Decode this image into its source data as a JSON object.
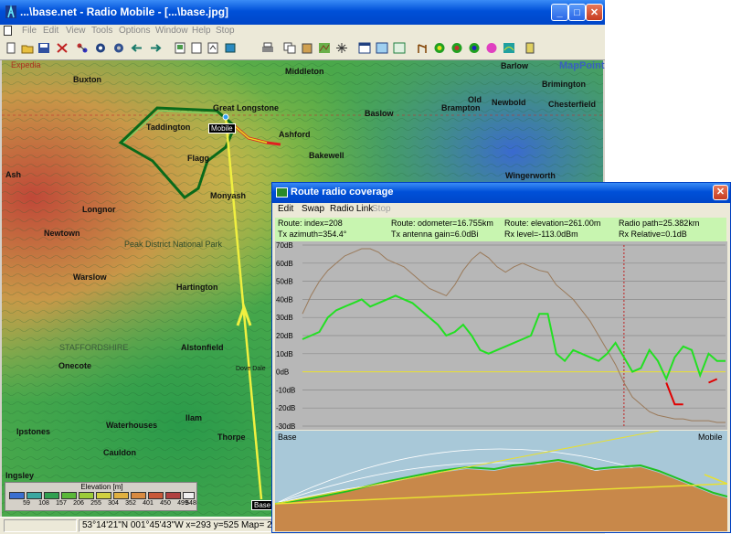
{
  "window": {
    "title": "...\\base.net - Radio Mobile - [...\\base.jpg]",
    "minimize": "_",
    "maximize": "□",
    "close": "✕"
  },
  "menu": [
    "File",
    "Edit",
    "View",
    "Tools",
    "Options",
    "Window",
    "Help",
    "Stop"
  ],
  "toolbar_icons": [
    "new-icon",
    "open-icon",
    "save-icon",
    "properties-icon",
    "network-icon",
    "units-icon",
    "systems-icon",
    "import-icon",
    "export-icon",
    "extract-icon",
    "pictures-icon",
    "elevation-icon",
    "merge-icon",
    "print-icon",
    "copy-icon",
    "paste-icon",
    "map-icon",
    "grid-icon",
    "window-icon",
    "zoom-icon",
    "fit-icon",
    "link-icon",
    "coverage-icon",
    "polar-icon",
    "cartesian-icon",
    "spectrum-icon",
    "rainbow-icon",
    "calculator-icon"
  ],
  "map": {
    "towns": [
      {
        "name": "Buxton"
      },
      {
        "name": "Middleton"
      },
      {
        "name": "Barlow"
      },
      {
        "name": "Brimington"
      },
      {
        "name": "Great Longstone"
      },
      {
        "name": "Old"
      },
      {
        "name": "Brampton"
      },
      {
        "name": "Newbold"
      },
      {
        "name": "Baslow"
      },
      {
        "name": "Chesterfield"
      },
      {
        "name": "Taddington"
      },
      {
        "name": "Ashford"
      },
      {
        "name": "Bakewell"
      },
      {
        "name": "Flagg"
      },
      {
        "name": "Wingerworth"
      },
      {
        "name": "Monyash"
      },
      {
        "name": "Longnor"
      },
      {
        "name": "Newtown"
      },
      {
        "name": "Peak District National Park"
      },
      {
        "name": "Warslow"
      },
      {
        "name": "Hartington"
      },
      {
        "name": "STAFFORDSHIRE"
      },
      {
        "name": "Onecote"
      },
      {
        "name": "Alstonfield"
      },
      {
        "name": "Ilam"
      },
      {
        "name": "Ipstones"
      },
      {
        "name": "Waterhouses"
      },
      {
        "name": "Thorpe"
      },
      {
        "name": "Cauldon"
      },
      {
        "name": "Ingsley"
      },
      {
        "name": "Expedia"
      },
      {
        "name": "MapPoint"
      },
      {
        "name": "Dove Dale"
      },
      {
        "name": "Ash"
      }
    ],
    "mobile_label": "Mobile",
    "base_label": "Base",
    "legend": {
      "title": "Elevation [m]",
      "values": [
        "59",
        "108",
        "157",
        "206",
        "255",
        "304",
        "352",
        "401",
        "450",
        "499",
        "548"
      ],
      "colors": [
        "#3a6fd0",
        "#3aa7a0",
        "#30a050",
        "#5ab838",
        "#9ccc38",
        "#d0d040",
        "#e0b040",
        "#d88a40",
        "#c85838",
        "#b04040",
        "#f0f0f0"
      ]
    }
  },
  "status": {
    "coords": "53°14'21\"N  001°45'43\"W  x=293 y=525 Map= 261m"
  },
  "coverage_window": {
    "title": "Route radio coverage",
    "close": "✕",
    "menu": [
      {
        "label": "Edit",
        "enabled": true
      },
      {
        "label": "Swap",
        "enabled": true
      },
      {
        "label": "Radio Link",
        "enabled": true
      },
      {
        "label": "Stop",
        "enabled": false
      }
    ],
    "info_row1": [
      "Route: index=208",
      "Route: odometer=16.755km",
      "Route: elevation=261.00m",
      "Radio path=25.382km"
    ],
    "info_row2": [
      "Tx azimuth=354.4°",
      "Tx antenna gain=6.0dBi",
      "Rx level=-113.0dBm",
      "Rx Relative=0.1dB"
    ],
    "profile_left": "Base",
    "profile_right": "Mobile"
  },
  "chart_data": {
    "type": "line",
    "y_ticks": [
      "70dB",
      "60dB",
      "50dB",
      "40dB",
      "30dB",
      "20dB",
      "10dB",
      "0dB",
      "-10dB",
      "-20dB",
      "-30dB"
    ],
    "ylim": [
      -30,
      70
    ],
    "cursor_x": 0.76,
    "x": [
      0,
      0.02,
      0.04,
      0.06,
      0.08,
      0.1,
      0.12,
      0.14,
      0.16,
      0.18,
      0.2,
      0.22,
      0.24,
      0.26,
      0.28,
      0.3,
      0.32,
      0.34,
      0.36,
      0.38,
      0.4,
      0.42,
      0.44,
      0.46,
      0.48,
      0.5,
      0.52,
      0.54,
      0.56,
      0.58,
      0.6,
      0.62,
      0.64,
      0.66,
      0.68,
      0.7,
      0.72,
      0.74,
      0.76,
      0.78,
      0.8,
      0.82,
      0.84,
      0.86,
      0.88,
      0.9,
      0.92,
      0.94,
      0.96,
      0.98,
      1.0
    ],
    "series": [
      {
        "color": "#9a7a5a",
        "values": [
          32,
          42,
          50,
          56,
          60,
          64,
          66,
          68,
          68,
          66,
          62,
          60,
          58,
          54,
          50,
          46,
          44,
          42,
          48,
          56,
          62,
          66,
          63,
          58,
          55,
          58,
          60,
          58,
          56,
          55,
          48,
          44,
          40,
          34,
          28,
          20,
          12,
          4,
          -6,
          -14,
          -18,
          -22,
          -24,
          -25,
          -26,
          -26,
          -27,
          -27,
          -27,
          -28,
          -28
        ]
      },
      {
        "color": "#22e022",
        "values": [
          18,
          20,
          22,
          30,
          34,
          36,
          38,
          40,
          36,
          38,
          40,
          42,
          40,
          38,
          34,
          30,
          26,
          20,
          22,
          26,
          20,
          12,
          10,
          12,
          14,
          16,
          18,
          20,
          32,
          32,
          10,
          6,
          12,
          10,
          8,
          6,
          10,
          16,
          8,
          0,
          2,
          12,
          6,
          -4,
          8,
          14,
          12,
          -2,
          10,
          6,
          6
        ]
      },
      {
        "color": "#e00000",
        "values": [
          null,
          null,
          null,
          null,
          null,
          null,
          null,
          null,
          null,
          null,
          null,
          null,
          null,
          null,
          null,
          null,
          null,
          null,
          null,
          null,
          null,
          null,
          null,
          null,
          null,
          null,
          null,
          null,
          null,
          null,
          null,
          null,
          null,
          null,
          null,
          null,
          null,
          null,
          null,
          null,
          null,
          null,
          null,
          -6,
          -18,
          -18,
          null,
          null,
          -6,
          -4,
          null
        ]
      }
    ]
  }
}
